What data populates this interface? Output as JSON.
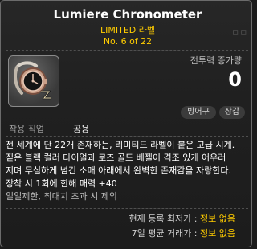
{
  "item": {
    "name": "Lumiere Chronometer",
    "grade": "LIMITED 라벨",
    "serial": "No. 6 of 22",
    "ghost_text": "ㅁㅁ",
    "icon_name": "pocket-watch-icon"
  },
  "stats": {
    "combat_power_label": "전투력 증가량",
    "combat_power_value": "0"
  },
  "tags": {
    "armor": "방어구",
    "equip": "장갑"
  },
  "requirements": {
    "job_label": "착용 직업",
    "job_value": "공용"
  },
  "description": {
    "lines": [
      "전 세계에 단 22개 존재하는, 리미티드 라벨이 붙은 고급 시계.",
      "짙은 블랙 컬러 다이얼과 로즈 골드 베젤이 격조 있게 어우러",
      "지며 무심하게 넘긴 소매 아래에서 완벽한 존재감을 자랑한다.",
      "장착 시 1회에 한해 매력 +40"
    ],
    "note": "일일제한, 최대치 초과 시 제외"
  },
  "price": {
    "lowest_label": "현재 등록 최저가 :",
    "lowest_value": "정보 없음",
    "avg_label": "7일 평균 거래가 :",
    "avg_value": "정보 없음"
  },
  "colors": {
    "accent": "#ffcc00",
    "background": "#1f1f1f",
    "border": "#6b6b6b"
  }
}
